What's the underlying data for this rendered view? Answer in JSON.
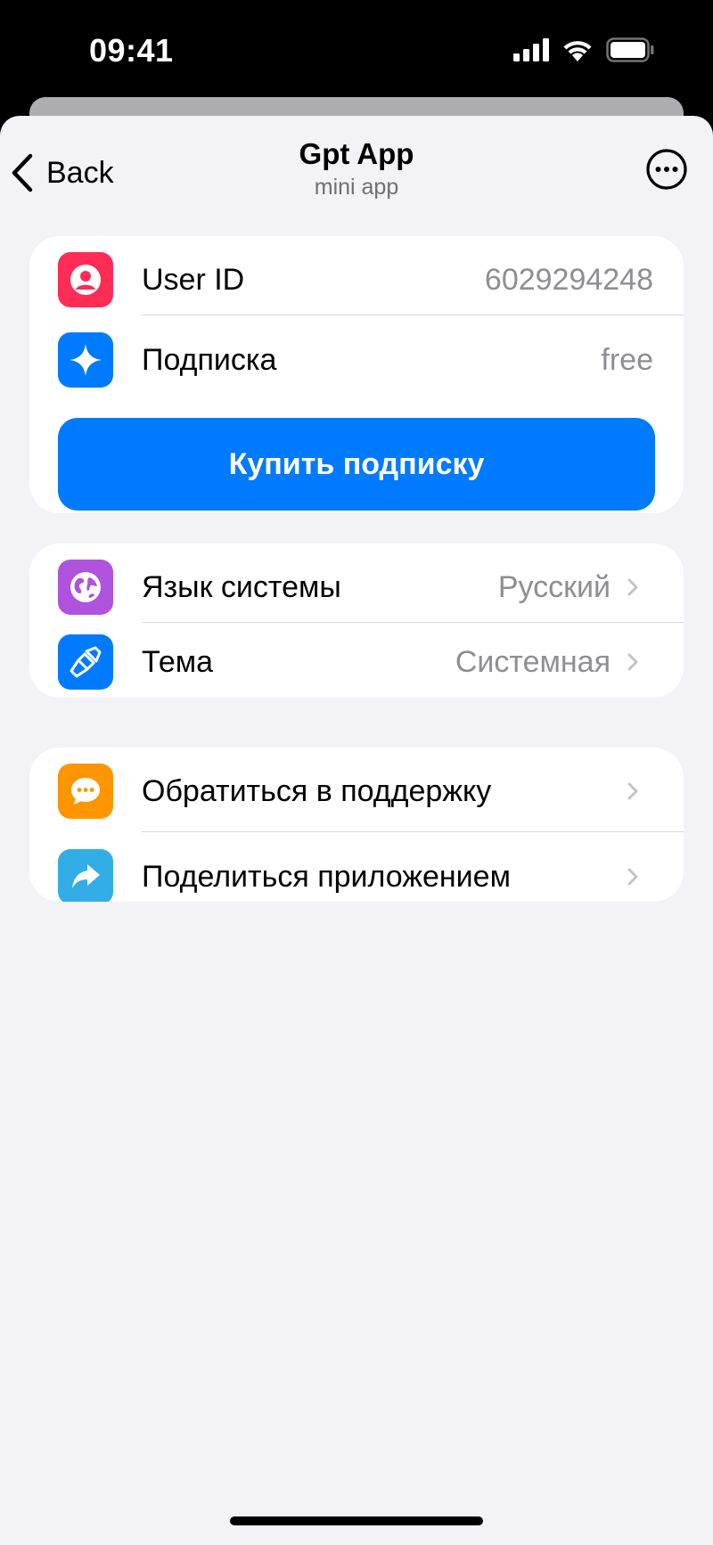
{
  "status_bar": {
    "time": "09:41"
  },
  "nav": {
    "back_label": "Back",
    "title": "Gpt App",
    "subtitle": "mini app"
  },
  "account": {
    "user_id_label": "User ID",
    "user_id_value": "6029294248",
    "subscription_label": "Подписка",
    "subscription_value": "free",
    "buy_button": "Купить подписку"
  },
  "settings": {
    "language_label": "Язык системы",
    "language_value": "Русский",
    "theme_label": "Тема",
    "theme_value": "Системная"
  },
  "support": {
    "contact_label": "Обратиться в поддержку",
    "share_label": "Поделиться приложением"
  },
  "icons": {
    "user": "person-icon",
    "subscription": "sparkle-icon",
    "language": "globe-icon",
    "theme": "brush-icon",
    "contact": "chat-bubble-icon",
    "share": "share-arrow-icon"
  },
  "colors": {
    "accent": "#007aff",
    "user_icon_bg": "#ff2d55",
    "subscription_icon_bg": "#007aff",
    "language_icon_bg": "#af52de",
    "theme_icon_bg": "#007aff",
    "contact_icon_bg": "#ff9500",
    "share_icon_bg": "#32ade6"
  }
}
